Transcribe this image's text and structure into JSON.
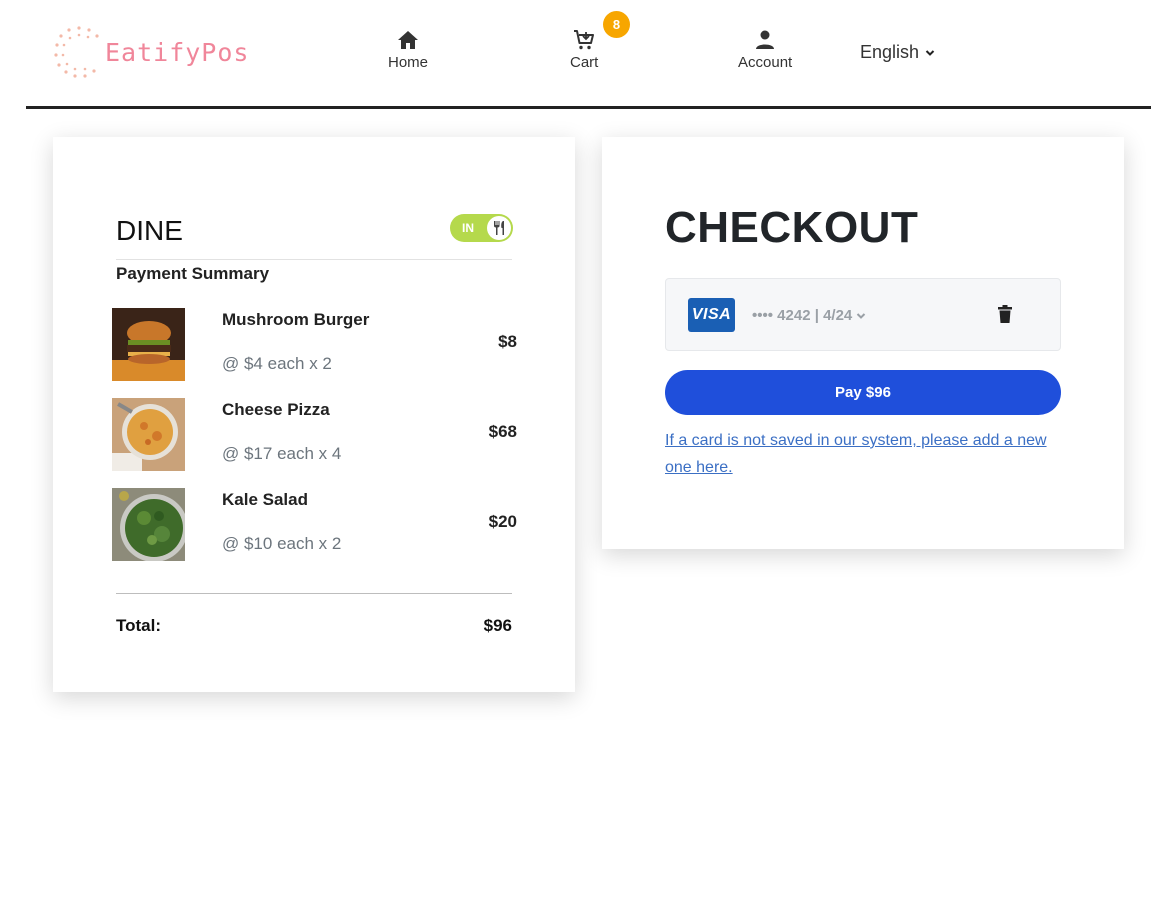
{
  "brand": {
    "name": "EatifyPos",
    "color": "#f0869a"
  },
  "nav": {
    "home": {
      "label": "Home",
      "icon": "home-icon"
    },
    "cart": {
      "label": "Cart",
      "icon": "cart-icon",
      "badge": "8"
    },
    "account": {
      "label": "Account",
      "icon": "user-icon"
    },
    "language": {
      "label": "English",
      "icon": "chevron-down-icon"
    }
  },
  "summary": {
    "dine_label": "DINE",
    "toggle": {
      "text": "IN",
      "state": "on",
      "icon": "utensils-icon",
      "color": "#b5d94c"
    },
    "heading": "Payment Summary",
    "items": [
      {
        "name": "Mushroom Burger",
        "qty_text": "@ $4 each x 2",
        "price": "$8",
        "image": "burger-photo"
      },
      {
        "name": "Cheese Pizza",
        "qty_text": "@ $17 each x 4",
        "price": "$68",
        "image": "pizza-photo"
      },
      {
        "name": "Kale Salad",
        "qty_text": "@ $10 each x 2",
        "price": "$20",
        "image": "salad-photo"
      }
    ],
    "total_label": "Total:",
    "total_value": "$96"
  },
  "checkout": {
    "title": "CHECKOUT",
    "card": {
      "brand": "VISA",
      "masked": "•••• 4242 | 4/24",
      "delete_icon": "trash-icon"
    },
    "pay_button": "Pay $96",
    "pay_color": "#1f4fdb",
    "add_card_link": "If a card is not saved in our system, please add a new one here."
  }
}
